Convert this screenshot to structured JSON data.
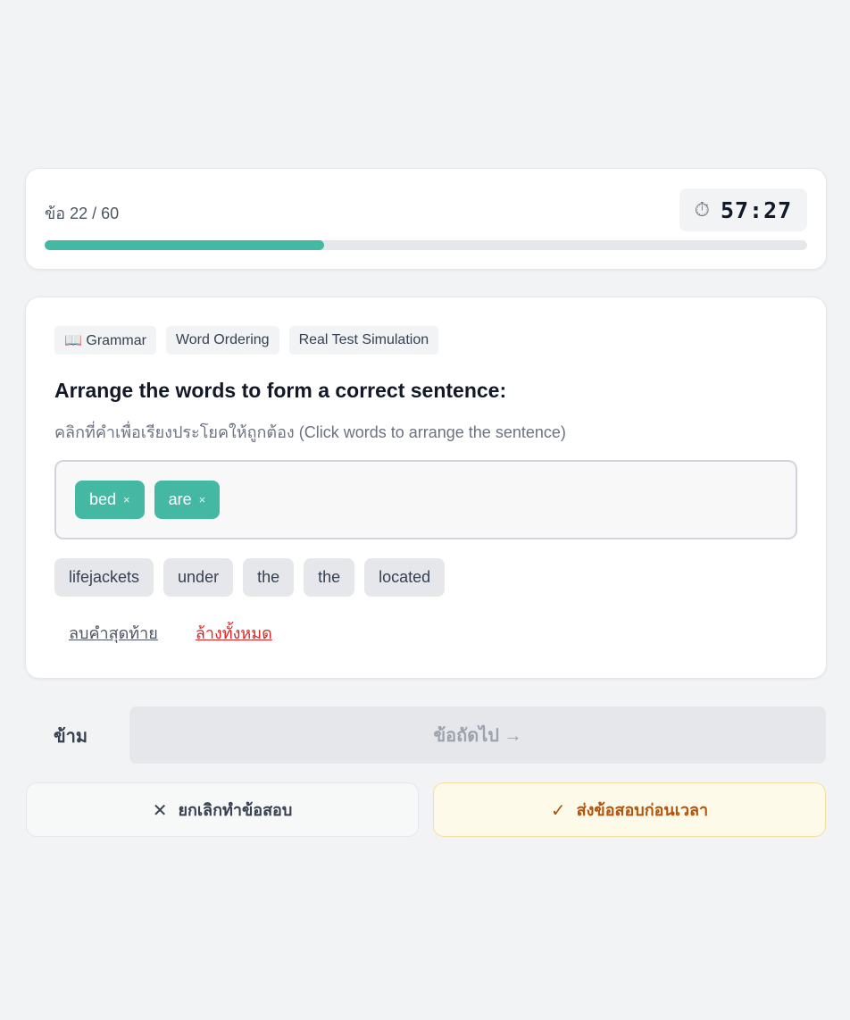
{
  "progress": {
    "label": "ข้อ 22 / 60",
    "current": 22,
    "total": 60,
    "fraction": 0.3667,
    "accent_color": "#45b8a4",
    "timer_icon": "stopwatch-icon",
    "timer_glyph": "⏱",
    "timer": "57:27"
  },
  "question": {
    "tags": [
      "📖 Grammar",
      "Word Ordering",
      "Real Test Simulation"
    ],
    "title": "Arrange the words to form a correct sentence:",
    "subtitle": "คลิกที่คำเพื่อเรียงประโยคให้ถูกต้อง (Click words to arrange the sentence)",
    "selected_words": [
      "bed",
      "are"
    ],
    "remove_glyph": "×",
    "word_bank": [
      "lifejackets",
      "under",
      "the",
      "the",
      "located"
    ],
    "undo_label": "ลบคำสุดท้าย",
    "clear_label": "ล้างทั้งหมด"
  },
  "nav": {
    "skip_label": "ข้าม",
    "next_label": "ข้อถัดไป →",
    "cancel_label": "ยกเลิกทำข้อสอบ",
    "cancel_icon": "close-icon",
    "cancel_glyph": "✕",
    "submit_label": "ส่งข้อสอบก่อนเวลา",
    "submit_icon": "check-icon",
    "submit_glyph": "✓"
  }
}
